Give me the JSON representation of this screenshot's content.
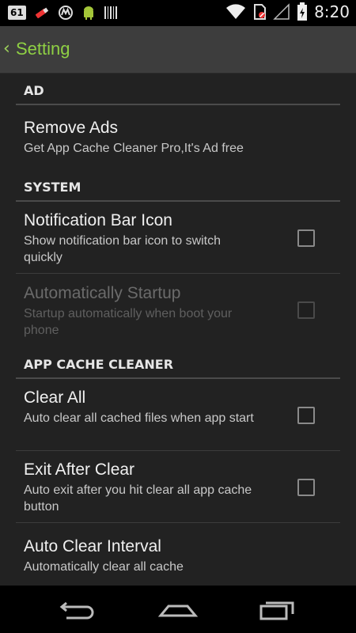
{
  "status_bar": {
    "badge": "61",
    "time": "8:20",
    "icons": [
      "notification-badge-icon",
      "lipstick-icon",
      "motorola-icon",
      "android-icon",
      "barcode-icon",
      "wifi-icon",
      "no-sim-icon",
      "signal-icon",
      "battery-icon"
    ]
  },
  "action_bar": {
    "back_glyph": "‹",
    "title": "Setting",
    "accent": "#8fd044"
  },
  "categories": {
    "ad": "AD",
    "system": "SYSTEM",
    "cleaner": "APP CACHE CLEANER"
  },
  "prefs": {
    "remove_ads": {
      "title": "Remove Ads",
      "summary": "Get App Cache Cleaner Pro,It's Ad free"
    },
    "notif_icon": {
      "title": "Notification Bar Icon",
      "summary": "Show notification bar icon to switch quickly",
      "checked": false
    },
    "auto_startup": {
      "title": "Automatically Startup",
      "summary": "Startup automatically when boot your phone",
      "checked": false,
      "enabled": false
    },
    "clear_all": {
      "title": "Clear All",
      "summary": "Auto clear all cached files when app start",
      "checked": false
    },
    "exit_after": {
      "title": "Exit After Clear",
      "summary": "Auto exit after you hit clear all app cache button",
      "checked": false
    },
    "interval": {
      "title": "Auto Clear Interval",
      "summary": "Automatically clear all cache"
    }
  },
  "nav_bar": {
    "icons": [
      "back-icon",
      "home-icon",
      "recents-icon"
    ]
  }
}
